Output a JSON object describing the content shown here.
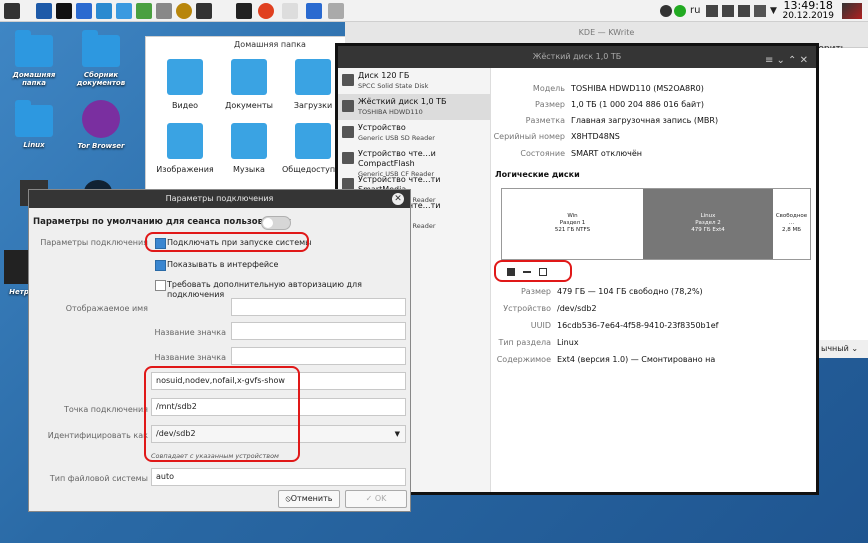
{
  "taskbar": {
    "lang": "ru",
    "time": "13:49:18",
    "date": "20.12.2019"
  },
  "desktop": {
    "icons": [
      {
        "label": "Домашняя папка"
      },
      {
        "label": "Сборник документов"
      },
      {
        "label": "Linux"
      },
      {
        "label": "Tor Browser"
      },
      {
        "label": "Нетр"
      }
    ]
  },
  "files": {
    "title": "Домашняя папка",
    "items": [
      "Видео",
      "Документы",
      "Загрузки",
      "Изображения",
      "Музыка",
      "Общедоступные"
    ]
  },
  "kde": {
    "title": "KDE — KWrite",
    "right_text": "орить",
    "bottom_text": "ычный"
  },
  "disks": {
    "title": "Жёсткий диск 1,0 ТБ",
    "devices": [
      {
        "name": "Диск 120 ГБ",
        "sub": "SPCC Solid State Disk"
      },
      {
        "name": "Жёсткий диск 1,0 ТБ",
        "sub": "TOSHIBA HDWD110"
      },
      {
        "name": "Устройство",
        "sub": "Generic USB SD Reader"
      },
      {
        "name": "Устройство чте…и CompactFlash",
        "sub": "Generic USB CF Reader"
      },
      {
        "name": "Устройство чте…ти SmartMedia",
        "sub": "Generic USB SM Reader"
      },
      {
        "name": "Устройство чте…ти MemoryStick",
        "sub": "Generic USB MS Reader"
      }
    ],
    "props": [
      {
        "label": "Модель",
        "value": "TOSHIBA HDWD110 (MS2OA8R0)"
      },
      {
        "label": "Размер",
        "value": "1,0 ТБ (1 000 204 886 016 байт)"
      },
      {
        "label": "Разметка",
        "value": "Главная загрузочная запись (MBR)"
      },
      {
        "label": "Серийный номер",
        "value": "X8HTD48NS"
      },
      {
        "label": "Состояние",
        "value": "SMART отключён"
      }
    ],
    "volumes_heading": "Логические диски",
    "partitions": [
      {
        "name": "Win",
        "sub1": "Раздел 1",
        "sub2": "521 ГБ NTFS"
      },
      {
        "name": "Linux",
        "sub1": "Раздел 2",
        "sub2": "479 ГБ Ext4"
      },
      {
        "name": "Свободное ...",
        "sub1": "",
        "sub2": "2,8 МБ"
      }
    ],
    "details": [
      {
        "label": "Размер",
        "value": "479 ГБ — 104 ГБ свободно (78,2%)"
      },
      {
        "label": "Устройство",
        "value": "/dev/sdb2"
      },
      {
        "label": "UUID",
        "value": "16cdb536-7e64-4f58-9410-23f8350b1ef"
      },
      {
        "label": "Тип раздела",
        "value": "Linux"
      },
      {
        "label": "Содержимое",
        "value": "Ext4 (версия 1.0) — Смонтировано на"
      }
    ]
  },
  "dialog": {
    "title": "Параметры подключения",
    "session_label": "Параметры по умолчанию для сеанса пользователя",
    "mount_options_label": "Параметры подключения",
    "cb_startup": "Подключать при запуске системы",
    "cb_show": "Показывать в интерфейсе",
    "cb_auth": "Требовать дополнительную авторизацию для подключения",
    "display_name_label": "Отображаемое имя",
    "icon_name_label": "Название значка",
    "symbolic_icon_label": "Название значка",
    "options_value": "nosuid,nodev,nofail,x-gvfs-show",
    "mount_point_label": "Точка подключения",
    "mount_point_value": "/mnt/sdb2",
    "identify_label": "Идентифицировать как",
    "identify_value": "/dev/sdb2",
    "identify_hint": "Совпадает с указанным устройством",
    "fs_type_label": "Тип файловой системы",
    "fs_type_value": "auto",
    "cancel": "Отменить",
    "ok": "OK"
  }
}
